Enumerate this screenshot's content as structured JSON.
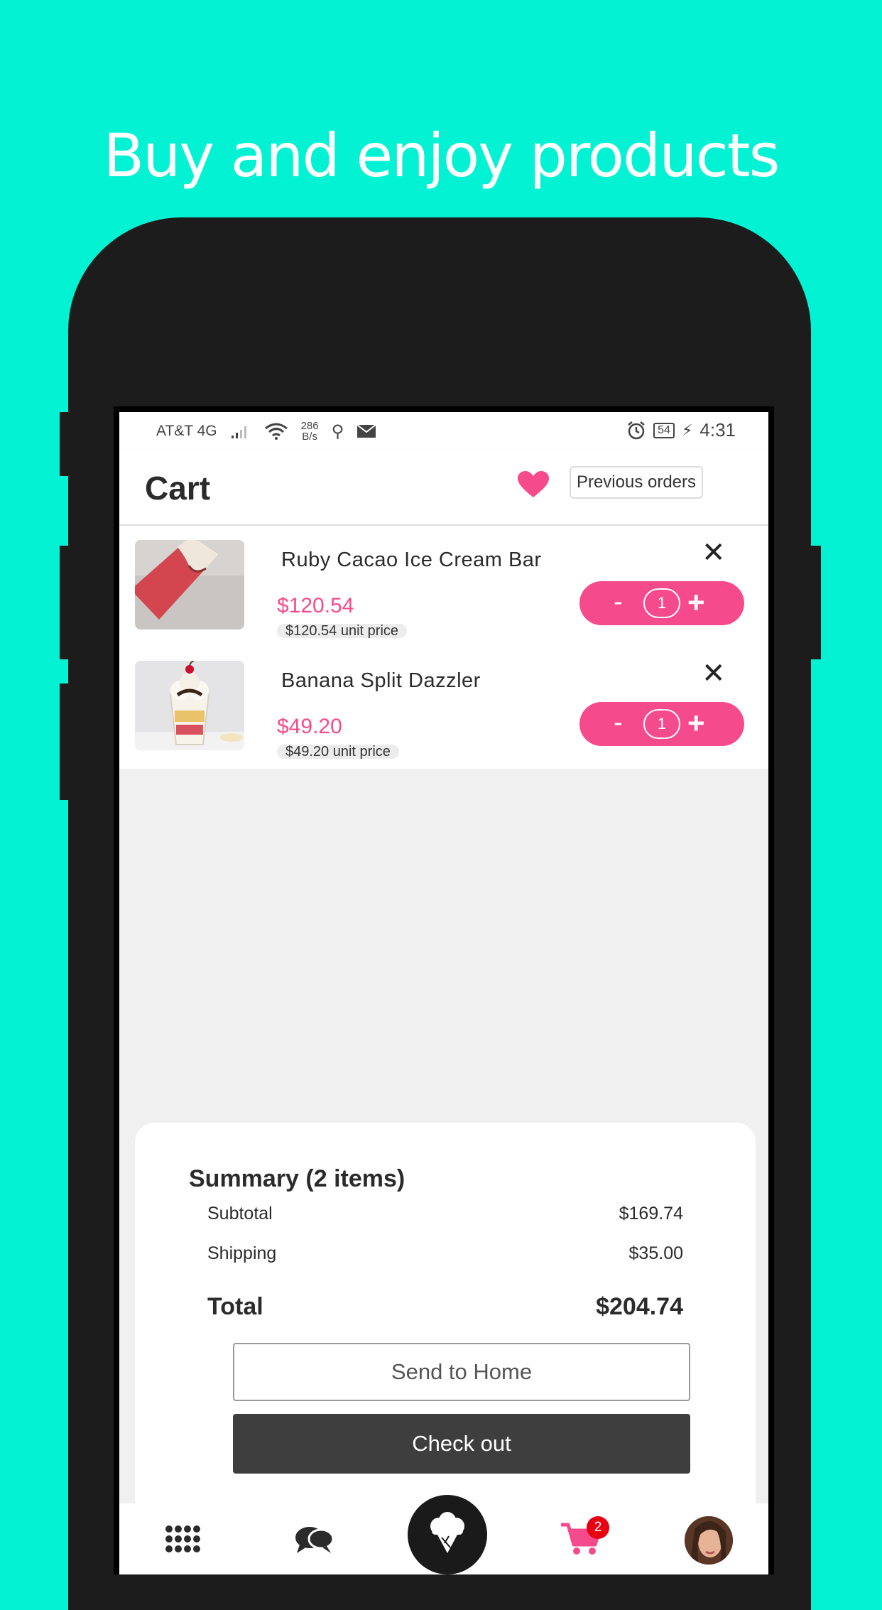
{
  "headline": "Buy and enjoy products",
  "status_bar": {
    "carrier": "AT&T 4G",
    "net_speed_value": "286",
    "net_speed_unit": "B/s",
    "battery": "54",
    "time": "4:31"
  },
  "appbar": {
    "title": "Cart",
    "previous_orders_label": "Previous orders"
  },
  "cart_items": [
    {
      "name": "Ruby Cacao Ice Cream Bar",
      "price": "$120.54",
      "unit_price": "$120.54 unit price",
      "quantity": "1"
    },
    {
      "name": "Banana Split Dazzler",
      "price": "$49.20",
      "unit_price": "$49.20 unit price",
      "quantity": "1"
    }
  ],
  "stepper": {
    "minus": "-",
    "plus": "+"
  },
  "remove_symbol": "✕",
  "summary": {
    "title": "Summary (2 items)",
    "subtotal_label": "Subtotal",
    "subtotal_value": "$169.74",
    "shipping_label": "Shipping",
    "shipping_value": "$35.00",
    "total_label": "Total",
    "total_value": "$204.74",
    "send_home_label": "Send to Home",
    "checkout_label": "Check out"
  },
  "navbar": {
    "cart_badge": "2",
    "items": [
      "apps-grid-icon",
      "chat-bubbles-icon",
      "ice-cream-icon",
      "cart-icon",
      "profile-avatar"
    ]
  },
  "colors": {
    "background": "#03f2d4",
    "accent_pink": "#f54b8c",
    "dark": "#3e3e3e",
    "badge_red": "#e60012"
  }
}
